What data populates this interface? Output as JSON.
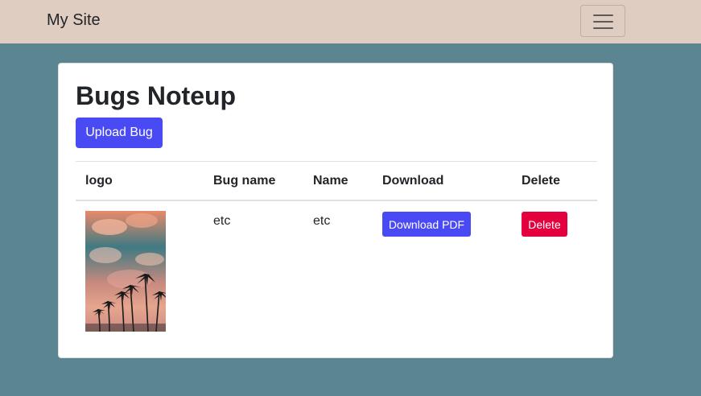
{
  "navbar": {
    "brand": "My Site",
    "toggler_icon": "hamburger-menu-icon"
  },
  "card": {
    "title": "Bugs Noteup",
    "upload_label": "Upload Bug",
    "table": {
      "headers": [
        "logo",
        "Bug name",
        "Name",
        "Download",
        "Delete"
      ],
      "rows": [
        {
          "logo_image": "palm-trees-sunset-image",
          "bug_name": "etc",
          "name": "etc",
          "download_label": "Download PDF",
          "delete_label": "Delete"
        }
      ]
    }
  },
  "colors": {
    "background": "#5b8591",
    "navbar": "#e0cdc1",
    "primary": "#4a4af4",
    "danger": "#e4003f"
  }
}
